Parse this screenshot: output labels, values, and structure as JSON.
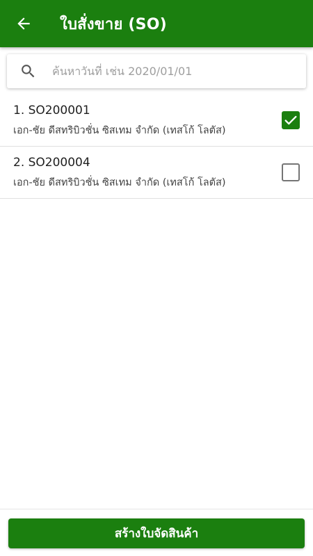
{
  "colors": {
    "primary": "#1b7f0f",
    "divider": "#e0e0e0",
    "checkbox_border": "#757575"
  },
  "appbar": {
    "title": "ใบสั่งขาย (SO)",
    "back_icon": "arrow-left-icon"
  },
  "search": {
    "icon": "search-icon",
    "value": "",
    "placeholder": "ค้นหาวันที่ เช่น 2020/01/01"
  },
  "orders": [
    {
      "title": "1. SO200001",
      "customer": "เอก-ชัย ดีสทริบิวชั่น ซิสเทม จำกัด (เทสโก้ โลตัส)",
      "checked": true
    },
    {
      "title": "2. SO200004",
      "customer": "เอก-ชัย ดีสทริบิวชั่น ซิสเทม จำกัด (เทสโก้ โลตัส)",
      "checked": false
    }
  ],
  "footer": {
    "create_label": "สร้างใบจัดสินค้า"
  }
}
